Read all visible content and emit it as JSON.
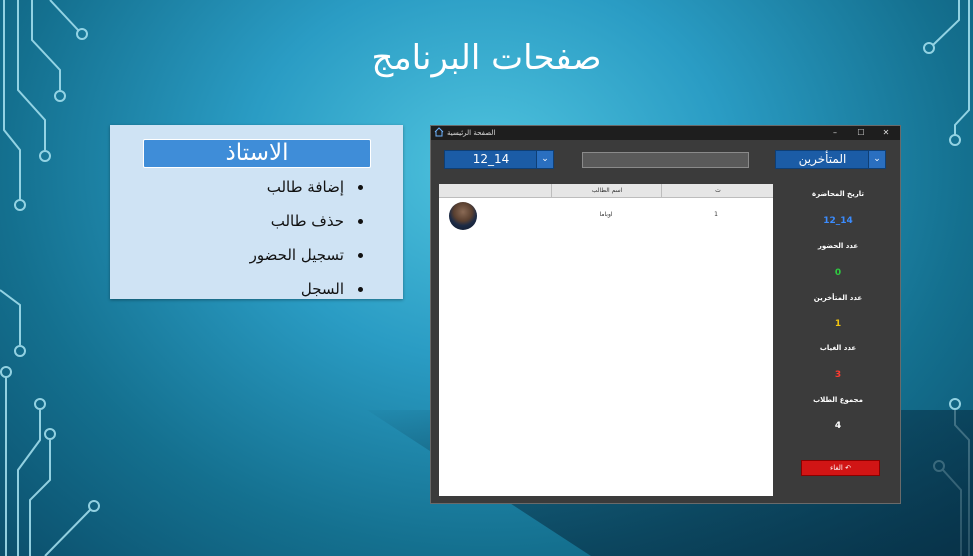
{
  "slide": {
    "title": "صفحات البرنامج"
  },
  "teacher_panel": {
    "header": "الاستاذ",
    "items": [
      {
        "label": "إضافة طالب"
      },
      {
        "label": "حذف طالب"
      },
      {
        "label": "تسجيل الحضور"
      },
      {
        "label": "السجل"
      }
    ]
  },
  "app": {
    "window_title": "الصفحة الرئيسية",
    "controls": {
      "minimize": "–",
      "maximize": "☐",
      "close": "✕"
    },
    "date_dropdown": {
      "value": "12_14"
    },
    "filter_dropdown": {
      "value": "المتأخرين"
    },
    "search": {
      "value": "",
      "placeholder": ""
    },
    "table": {
      "columns": [
        "اسم الطالب",
        "ت"
      ],
      "rows": [
        {
          "name": "اوباما",
          "number": "1"
        }
      ]
    },
    "stats": {
      "lecture_date_label": "تاريخ المحاضرة",
      "lecture_date_value": "12_14",
      "present_label": "عدد الحضور",
      "present_value": "0",
      "late_label": "عدد المتأخرين",
      "late_value": "1",
      "absent_label": "عدد الغياب",
      "absent_value": "3",
      "total_label": "مجموع الطلاب",
      "total_value": "4"
    },
    "cancel_button": {
      "label": "الغاء"
    }
  },
  "colors": {
    "accent_blue": "#1b5ca6",
    "date_value": "#3b8cff",
    "present": "#2ecc40",
    "late": "#f1c40f",
    "absent": "#ff3b30",
    "total": "#ffffff",
    "cancel": "#d11515"
  }
}
